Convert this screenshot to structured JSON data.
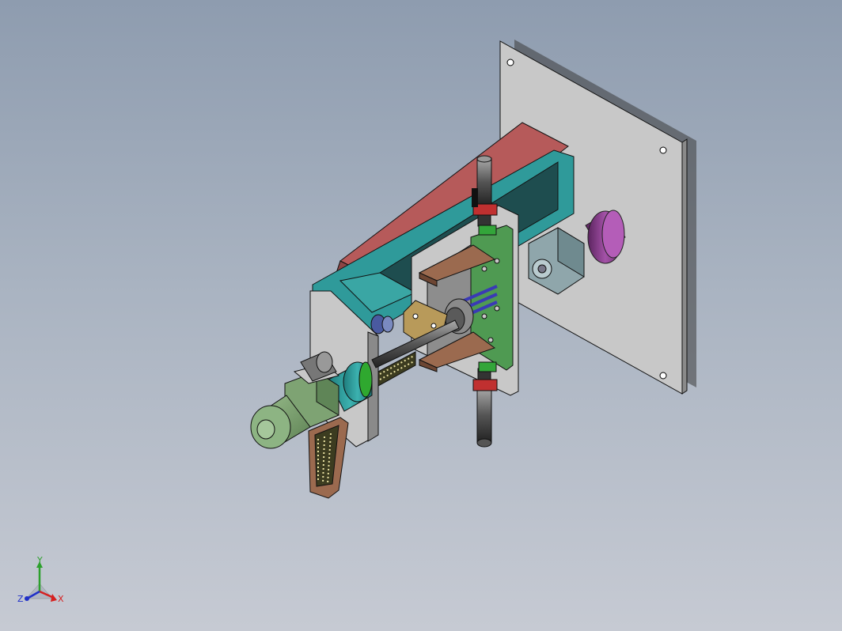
{
  "viewport": {
    "background_top": "#8e9caf",
    "background_bottom": "#c6cad3"
  },
  "model": {
    "part_colors": {
      "base_plate": "#c4c4c4",
      "frame_teal": "#2f9a9a",
      "frame_dark": "#1e4d4f",
      "gusset_red": "#b65a5a",
      "motor_purple": "#8e3f92",
      "motor_green": "#7ea373",
      "gearbox_blue": "#8ea6ab",
      "pcb_green": "#4f9a52",
      "wedge_brown": "#9b6a4f",
      "guide_tan": "#b89a5a"
    }
  },
  "triad": {
    "x_label": "X",
    "y_label": "Y",
    "z_label": "Z",
    "x_color": "#d62020",
    "y_color": "#2ca02c",
    "z_color": "#2030c8"
  }
}
